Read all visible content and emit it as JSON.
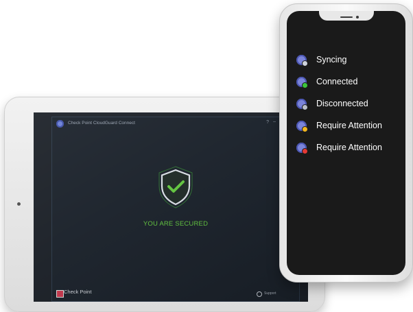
{
  "tablet": {
    "app_title": "Check Point CloudGuard Connect",
    "window_controls": {
      "help": "?",
      "minimize": "–",
      "close": "✕"
    },
    "status_message": "YOU ARE SECURED",
    "brand": "Check Point",
    "support_label": "Support",
    "accent_color": "#62c43f"
  },
  "phone": {
    "statuses": [
      {
        "label": "Syncing",
        "badge_color": "#cfd3dc",
        "badge_icon": "sync-badge-icon"
      },
      {
        "label": "Connected",
        "badge_color": "#3cc43c",
        "badge_icon": "connected-badge-icon"
      },
      {
        "label": "Disconnected",
        "badge_color": "#b9bec8",
        "badge_icon": "disconnected-badge-icon"
      },
      {
        "label": "Require Attention",
        "badge_color": "#f2b61f",
        "badge_icon": "warning-badge-icon"
      },
      {
        "label": "Require Attention",
        "badge_color": "#e53935",
        "badge_icon": "error-badge-icon"
      }
    ]
  }
}
